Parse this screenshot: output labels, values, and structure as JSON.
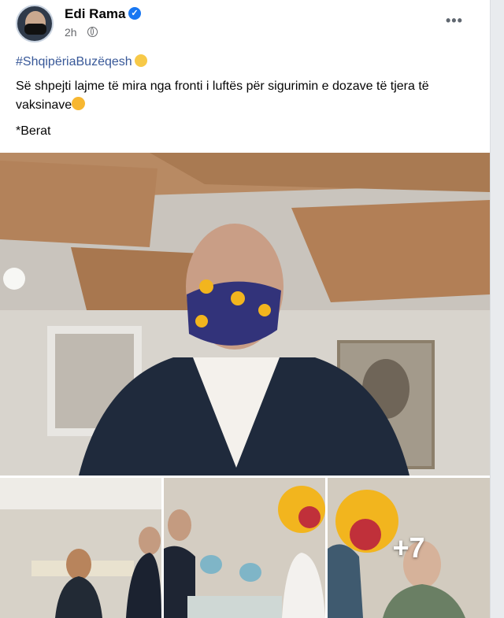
{
  "post": {
    "author": "Edi Rama",
    "verified_mark": "✓",
    "time": "2h",
    "privacy_icon": "globe-icon",
    "more_label": "•••",
    "hashtag": "#ShqipëriaBuzëqesh",
    "text": "Së shpejti lajme të mira nga fronti i luftës për sigurimin e dozave të tjera të vaksinave",
    "location": "*Berat"
  },
  "photos": {
    "more_count": "+7"
  },
  "colors": {
    "link": "#385898",
    "verified": "#1877f2",
    "text": "#050505",
    "meta": "#65676b"
  }
}
